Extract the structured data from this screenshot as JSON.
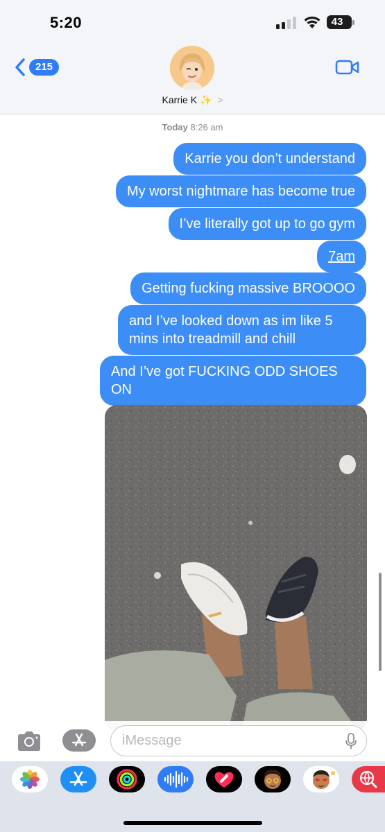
{
  "status_bar": {
    "time": "5:20",
    "battery": "43"
  },
  "header": {
    "back_count": "215",
    "contact_name": "Karrie K",
    "contact_emoji": "✨",
    "chevron": ">"
  },
  "conversation": {
    "timestamp_day": "Today",
    "timestamp_time": "8:26 am",
    "messages": [
      "Karrie you don’t understand",
      "My worst nightmare has become true",
      "I’ve literally got up to go gym",
      "7am",
      "Getting fucking massive BROOOO",
      "and I’ve looked down as im like 5 mins into treadmill and chill",
      "And I’ve got FUCKING ODD SHOES ON"
    ],
    "attachment": "photo of feet wearing odd shoes"
  },
  "input": {
    "placeholder": "iMessage"
  },
  "app_drawer": {
    "apps": [
      "photos-app-icon",
      "app-store-app-icon",
      "activity-app-icon",
      "audio-message-app-icon",
      "digital-touch-app-icon",
      "memoji-app-icon",
      "memoji-stickers-app-icon",
      "web-search-app-icon"
    ]
  },
  "colors": {
    "bubble_blue": "#3d8df7",
    "accent_blue": "#2f7cf6"
  }
}
